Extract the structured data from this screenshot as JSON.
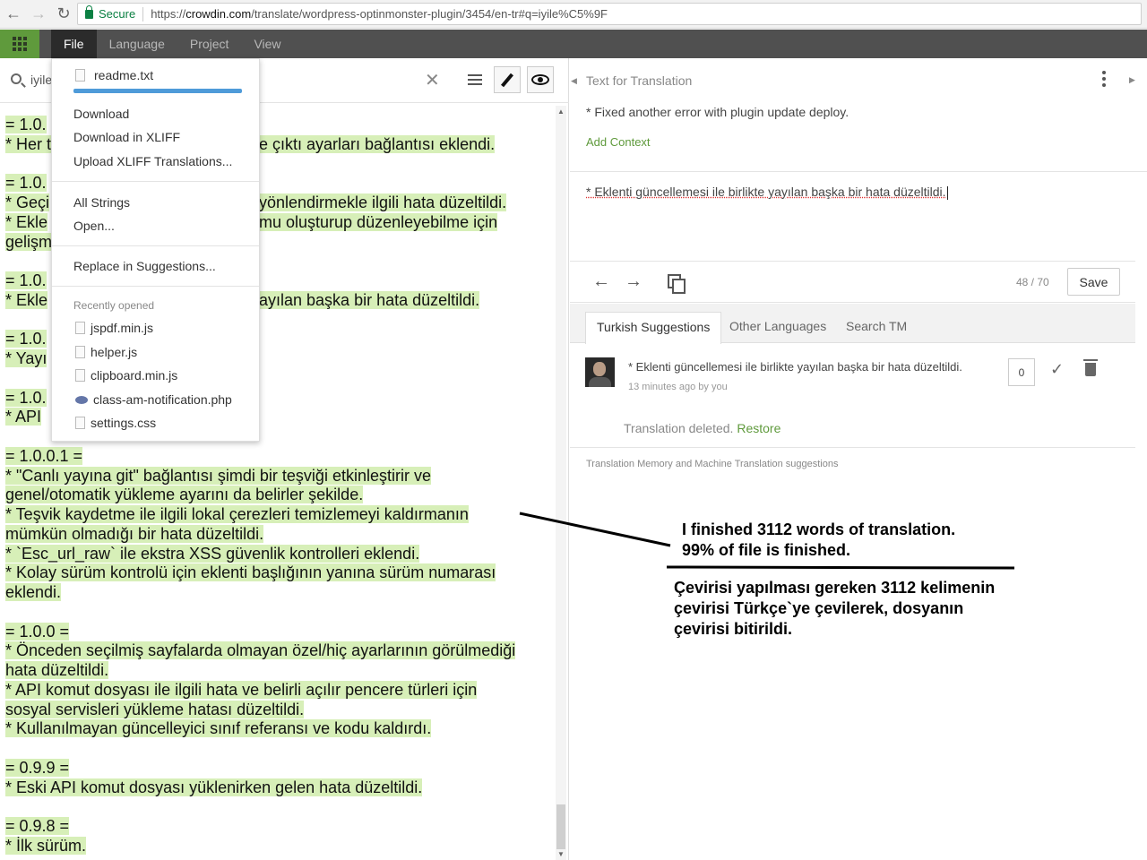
{
  "browser": {
    "secure_label": "Secure",
    "url_scheme": "https://",
    "url_host": "crowdin.com",
    "url_path": "/translate/wordpress-optinmonster-plugin/3454/en-tr#q=iyile%C5%9F"
  },
  "menubar": {
    "items": [
      "File",
      "Language",
      "Project",
      "View"
    ]
  },
  "toolbar": {
    "search_value": "iyile"
  },
  "file_menu": {
    "current_file": "readme.txt",
    "group1": [
      "Download",
      "Download in XLIFF",
      "Upload XLIFF Translations..."
    ],
    "group2": [
      "All Strings",
      "Open..."
    ],
    "group3": [
      "Replace in Suggestions..."
    ],
    "recent_header": "Recently opened",
    "recent_files": [
      "jspdf.min.js",
      "helper.js",
      "clipboard.min.js",
      "class-am-notification.php",
      "settings.css"
    ]
  },
  "document": {
    "lines": [
      {
        "text": "= 1.0.",
        "hl": true
      },
      {
        "text": "* Her t",
        "hl": true,
        "tail": "e çıktı ayarları bağlantısı eklendi."
      },
      {
        "text": "",
        "hl": false
      },
      {
        "text": "= 1.0.",
        "hl": true
      },
      {
        "text": "* Geçi",
        "hl": true,
        "tail": "yönlendirmekle ilgili hata düzeltildi."
      },
      {
        "text": "* Ekle",
        "hl": true,
        "tail": "mu oluşturup düzenleyebilme için"
      },
      {
        "text": "gelişm",
        "hl": true
      },
      {
        "text": "",
        "hl": false
      },
      {
        "text": "= 1.0.",
        "hl": true
      },
      {
        "text": "* Ekle",
        "hl": true,
        "tail": "ayılan başka bir hata düzeltildi."
      },
      {
        "text": "",
        "hl": false
      },
      {
        "text": "= 1.0.",
        "hl": true
      },
      {
        "text": "* Yayı",
        "hl": true
      },
      {
        "text": "",
        "hl": false
      },
      {
        "text": "= 1.0.",
        "hl": true
      },
      {
        "text": "* API",
        "hl": true
      },
      {
        "text": "",
        "hl": false
      },
      {
        "text": "= 1.0.0.1 =",
        "hl": true
      },
      {
        "text": "* \"Canlı yayına git\" bağlantısı şimdi bir teşviği etkinleştirir ve",
        "hl": true
      },
      {
        "text": "genel/otomatik yükleme ayarını da belirler şekilde.",
        "hl": true
      },
      {
        "text": "* Teşvik kaydetme ile ilgili lokal çerezleri temizlemeyi kaldırmanın",
        "hl": true
      },
      {
        "text": "mümkün olmadığı bir hata düzeltildi.",
        "hl": true
      },
      {
        "text": "* `Esc_url_raw` ile ekstra XSS güvenlik kontrolleri eklendi.",
        "hl": true
      },
      {
        "text": "* Kolay sürüm kontrolü için eklenti başlığının yanına sürüm numarası",
        "hl": true
      },
      {
        "text": "eklendi.",
        "hl": true
      },
      {
        "text": "",
        "hl": false
      },
      {
        "text": "= 1.0.0 =",
        "hl": true
      },
      {
        "text": "* Önceden seçilmiş sayfalarda olmayan özel/hiç ayarlarının görülmediği",
        "hl": true
      },
      {
        "text": "hata düzeltildi.",
        "hl": true
      },
      {
        "text": "* API komut dosyası ile ilgili hata ve belirli açılır pencere türleri için",
        "hl": true
      },
      {
        "text": "sosyal servisleri yükleme hatası düzeltildi.",
        "hl": true
      },
      {
        "text": "* Kullanılmayan güncelleyici sınıf referansı ve kodu kaldırdı.",
        "hl": true
      },
      {
        "text": "",
        "hl": false
      },
      {
        "text": "= 0.9.9 =",
        "hl": true
      },
      {
        "text": "* Eski API komut dosyası yüklenirken gelen hata düzeltildi.",
        "hl": true
      },
      {
        "text": "",
        "hl": false
      },
      {
        "text": "= 0.9.8 =",
        "hl": true
      },
      {
        "text": "* İlk sürüm.",
        "hl": true
      }
    ]
  },
  "editor": {
    "label": "Text for Translation",
    "source_text": "* Fixed another error with plugin update deploy.",
    "add_context": "Add Context",
    "translation_text": "* Eklenti güncellemesi ile birlikte yayılan başka bir hata düzeltildi.",
    "counter": "48 / 70",
    "save_label": "Save"
  },
  "tabs": [
    "Turkish Suggestions",
    "Other Languages",
    "Search TM"
  ],
  "suggestion": {
    "text": "* Eklenti güncellemesi ile birlikte yayılan başka bir hata düzeltildi.",
    "meta": "13 minutes ago by you",
    "votes": "0",
    "deleted_text": "Translation deleted.",
    "restore_label": "Restore"
  },
  "tm_label": "Translation Memory and Machine Translation suggestions",
  "annotation": {
    "english": [
      "I finished 3112 words of translation.",
      "99% of file is finished."
    ],
    "turkish": [
      "Çevirisi yapılması gereken 3112 kelimenin",
      "çevirisi Türkçe`ye çevilerek, dosyanın",
      "çevirisi bitirildi."
    ]
  }
}
